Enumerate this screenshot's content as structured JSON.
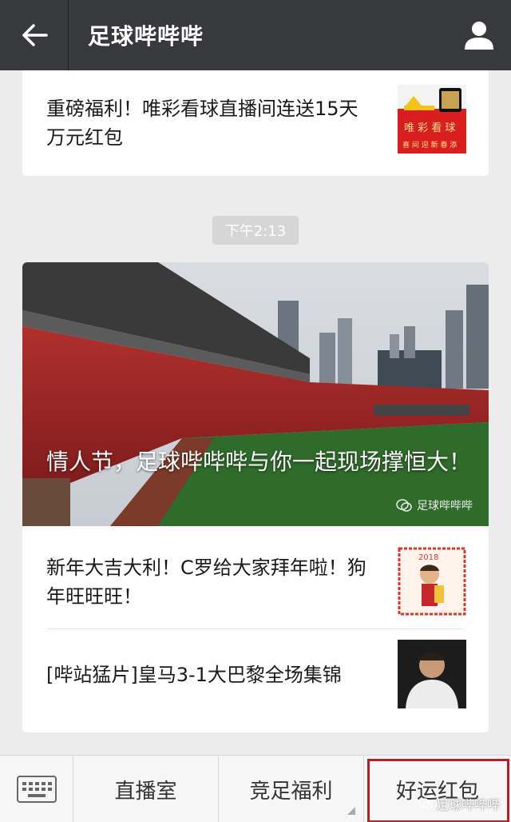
{
  "header": {
    "title": "足球哔哔哔"
  },
  "articles_top": [
    {
      "title": "重磅福利！唯彩看球直播间连送15天万元红包"
    }
  ],
  "time_badge": "下午2:13",
  "hero": {
    "title": "情人节，足球哔哔哔与你一起现场撑恒大！",
    "watermark": "足球哔哔哔"
  },
  "articles": [
    {
      "title": "新年大吉大利！C罗给大家拜年啦！狗年旺旺旺！"
    },
    {
      "title": "[哔站猛片]皇马3-1大巴黎全场集锦"
    }
  ],
  "menu": {
    "items": [
      "直播室",
      "竞足福利",
      "好运红包"
    ]
  },
  "watermark_bottom": "足球哔哔哔",
  "colors": {
    "topbar": "#37393c",
    "highlight": "#b0222a"
  }
}
